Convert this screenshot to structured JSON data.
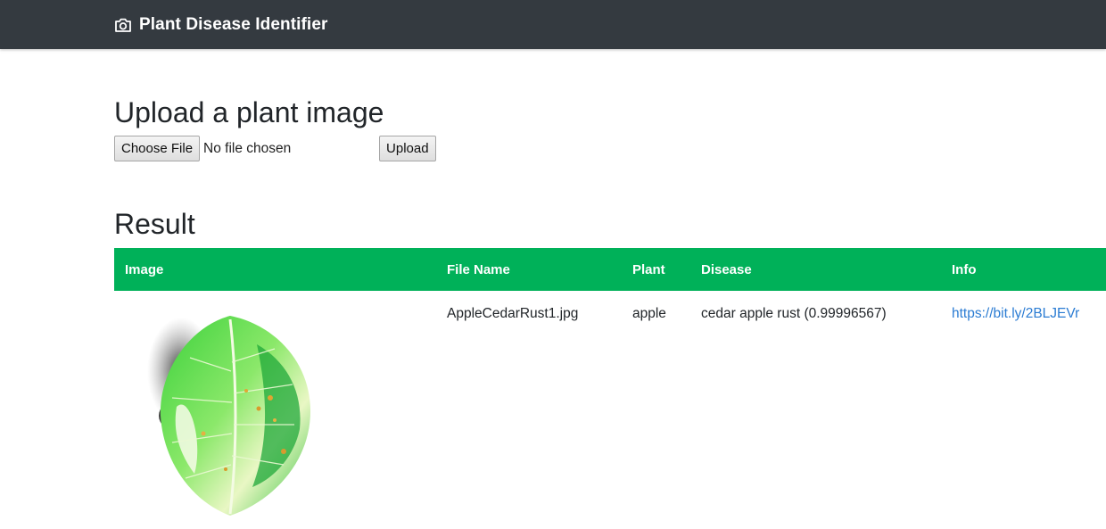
{
  "navbar": {
    "icon": "camera-icon",
    "title": "Plant Disease Identifier",
    "bg_color": "#343a40"
  },
  "upload": {
    "heading": "Upload a plant image",
    "choose_file_label": "Choose File",
    "file_status": "No file chosen",
    "upload_label": "Upload"
  },
  "result": {
    "heading": "Result",
    "header_color": "#00b159",
    "columns": [
      "Image",
      "File Name",
      "Plant",
      "Disease",
      "Info"
    ],
    "rows": [
      {
        "image": "leaf-image",
        "file_name": "AppleCedarRust1.jpg",
        "plant": "apple",
        "disease": "cedar apple rust (0.99996567)",
        "info": "https://bit.ly/2BLJEVr"
      }
    ]
  }
}
